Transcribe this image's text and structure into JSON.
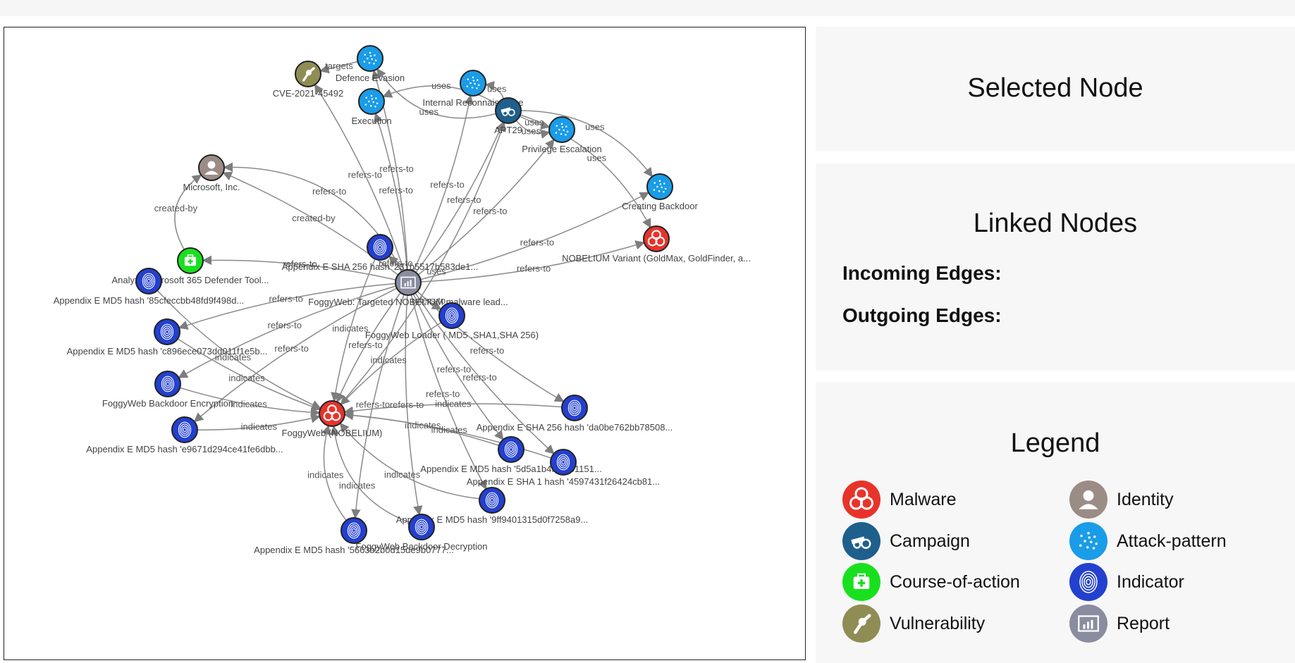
{
  "panels": {
    "selected_title": "Selected Node",
    "linked_title": "Linked Nodes",
    "incoming_label": "Incoming Edges:",
    "outgoing_label": "Outgoing Edges:",
    "legend_title": "Legend"
  },
  "legend": [
    {
      "label": "Malware",
      "type": "malware",
      "color": "#e8332b",
      "icon": "biohazard-icon"
    },
    {
      "label": "Identity",
      "type": "identity",
      "color": "#9b8c86",
      "icon": "person-icon"
    },
    {
      "label": "Campaign",
      "type": "campaign",
      "color": "#1f5f8b",
      "icon": "cannon-icon"
    },
    {
      "label": "Attack-pattern",
      "type": "attack-pattern",
      "color": "#1a9ce8",
      "icon": "dots-pattern-icon"
    },
    {
      "label": "Course-of-action",
      "type": "course-of-action",
      "color": "#19e01f",
      "icon": "first-aid-kit-icon"
    },
    {
      "label": "Indicator",
      "type": "indicator",
      "color": "#2340cf",
      "icon": "fingerprint-icon"
    },
    {
      "label": "Vulnerability",
      "type": "vulnerability",
      "color": "#8f8d54",
      "icon": "bug-icon"
    },
    {
      "label": "Report",
      "type": "report",
      "color": "#8a8da0",
      "icon": "report-chart-icon"
    }
  ],
  "graph": {
    "nodes": [
      {
        "id": "defence-evasion",
        "label": "Defence Evasion",
        "type": "attack-pattern"
      },
      {
        "id": "cve",
        "label": "CVE-2021-45492",
        "type": "vulnerability"
      },
      {
        "id": "internal-recon",
        "label": "Internal Reconnaissance",
        "type": "attack-pattern"
      },
      {
        "id": "execution",
        "label": "Execution",
        "type": "attack-pattern"
      },
      {
        "id": "apt29",
        "label": "APT29",
        "type": "campaign"
      },
      {
        "id": "priv-esc",
        "label": "Privilege Escalation",
        "type": "attack-pattern"
      },
      {
        "id": "microsoft",
        "label": "Microsoft, Inc.",
        "type": "identity"
      },
      {
        "id": "creating-backdoor",
        "label": "Creating Backdoor",
        "type": "attack-pattern"
      },
      {
        "id": "nobelium-variant",
        "label": "NOBELIUM Variant (GoldMax, GoldFinder, a...",
        "type": "malware"
      },
      {
        "id": "sha256-231",
        "label": "Appendix E SHA 256 hash '231b5517b583de1...",
        "type": "indicator"
      },
      {
        "id": "analyze-365",
        "label": "Analyze Microsoft 365 Defender Tool...",
        "type": "course-of-action"
      },
      {
        "id": "md5-85cf",
        "label": "Appendix E MD5 hash '85cfeccbb48fd9f498d...",
        "type": "indicator"
      },
      {
        "id": "report",
        "label": "FoggyWeb: Targeted NOBELIUM malware lead...",
        "type": "report"
      },
      {
        "id": "loader",
        "label": "FoggyWeb Loader ( MD5 ,SHA1,SHA 256)",
        "type": "indicator"
      },
      {
        "id": "md5-c89",
        "label": "Appendix E MD5 hash 'c896ece073dd011f1e5b...",
        "type": "indicator"
      },
      {
        "id": "backdoor-enc",
        "label": "FoggyWeb Backdoor Encryption",
        "type": "indicator"
      },
      {
        "id": "foggyweb",
        "label": "FoggyWeb (NOBELIUM)",
        "type": "malware"
      },
      {
        "id": "sha256-da0",
        "label": "Appendix E SHA 256 hash 'da0be762bb78508...",
        "type": "indicator"
      },
      {
        "id": "md5-e96",
        "label": "Appendix E MD5 hash 'e9671d294ce41fe6dbb...",
        "type": "indicator"
      },
      {
        "id": "md5-5d5",
        "label": "Appendix E MD5 hash '5d5a1b4fa7d51151...",
        "type": "indicator"
      },
      {
        "id": "sha1-459",
        "label": "Appendix E SHA 1 hash '4597431f26424cb81...",
        "type": "indicator"
      },
      {
        "id": "md5-9ff",
        "label": "Appendix E MD5 hash '9ff9401315d0f7258a9...",
        "type": "indicator"
      },
      {
        "id": "md5-566",
        "label": "Appendix E MD5 hash '5663b2b0d15de9b0777...",
        "type": "indicator"
      },
      {
        "id": "backdoor-dec",
        "label": "FoggyWeb Backdoor Decryption",
        "type": "indicator"
      }
    ],
    "edges": [
      {
        "from": "apt29",
        "to": "defence-evasion",
        "label": "uses"
      },
      {
        "from": "defence-evasion",
        "to": "cve",
        "label": "targets"
      },
      {
        "from": "apt29",
        "to": "execution",
        "label": "uses"
      },
      {
        "from": "apt29",
        "to": "internal-recon",
        "label": "uses"
      },
      {
        "from": "apt29",
        "to": "priv-esc",
        "label": "uses"
      },
      {
        "from": "apt29",
        "to": "priv-esc",
        "label": "uses"
      },
      {
        "from": "apt29",
        "to": "creating-backdoor",
        "label": "uses"
      },
      {
        "from": "apt29",
        "to": "nobelium-variant",
        "label": "uses"
      },
      {
        "from": "analyze-365",
        "to": "microsoft",
        "label": "created-by"
      },
      {
        "from": "report",
        "to": "microsoft",
        "label": "created-by"
      },
      {
        "from": "report",
        "to": "cve",
        "label": "refers-to"
      },
      {
        "from": "report",
        "to": "defence-evasion",
        "label": "refers-to"
      },
      {
        "from": "report",
        "to": "execution",
        "label": "refers-to"
      },
      {
        "from": "report",
        "to": "internal-recon",
        "label": "refers-to"
      },
      {
        "from": "report",
        "to": "apt29",
        "label": "refers-to"
      },
      {
        "from": "report",
        "to": "priv-esc",
        "label": "refers-to"
      },
      {
        "from": "report",
        "to": "creating-backdoor",
        "label": "refers-to"
      },
      {
        "from": "report",
        "to": "nobelium-variant",
        "label": "refers-to"
      },
      {
        "from": "report",
        "to": "microsoft",
        "label": "refers-to"
      },
      {
        "from": "report",
        "to": "analyze-365",
        "label": "refers-to"
      },
      {
        "from": "report",
        "to": "sha256-231",
        "label": "refers-to"
      },
      {
        "from": "report",
        "to": "md5-c89",
        "label": "refers-to"
      },
      {
        "from": "report",
        "to": "backdoor-enc",
        "label": "refers-to"
      },
      {
        "from": "report",
        "to": "md5-e96",
        "label": "refers-to"
      },
      {
        "from": "report",
        "to": "loader",
        "label": "refers-to"
      },
      {
        "from": "report",
        "to": "sha256-da0",
        "label": "refers-to"
      },
      {
        "from": "report",
        "to": "md5-5d5",
        "label": "refers-to"
      },
      {
        "from": "report",
        "to": "sha1-459",
        "label": "refers-to"
      },
      {
        "from": "report",
        "to": "md5-9ff",
        "label": "refers-to"
      },
      {
        "from": "report",
        "to": "md5-566",
        "label": "refers-to"
      },
      {
        "from": "report",
        "to": "backdoor-dec",
        "label": "refers-to"
      },
      {
        "from": "report",
        "to": "foggyweb",
        "label": "refers-to"
      },
      {
        "from": "foggyweb",
        "to": "apt29",
        "label": "uses"
      },
      {
        "from": "md5-85cf",
        "to": "foggyweb",
        "label": "indicates"
      },
      {
        "from": "md5-c89",
        "to": "foggyweb",
        "label": "indicates"
      },
      {
        "from": "backdoor-enc",
        "to": "foggyweb",
        "label": "indicates"
      },
      {
        "from": "md5-e96",
        "to": "foggyweb",
        "label": "indicates"
      },
      {
        "from": "sha256-231",
        "to": "foggyweb",
        "label": "indicates"
      },
      {
        "from": "loader",
        "to": "foggyweb",
        "label": "indicates"
      },
      {
        "from": "sha256-da0",
        "to": "foggyweb",
        "label": "indicates"
      },
      {
        "from": "md5-5d5",
        "to": "foggyweb",
        "label": "indicates"
      },
      {
        "from": "sha1-459",
        "to": "foggyweb",
        "label": "indicates"
      },
      {
        "from": "md5-9ff",
        "to": "foggyweb",
        "label": "indicates"
      },
      {
        "from": "md5-566",
        "to": "foggyweb",
        "label": "indicates"
      },
      {
        "from": "backdoor-dec",
        "to": "foggyweb",
        "label": "indicates"
      }
    ]
  }
}
